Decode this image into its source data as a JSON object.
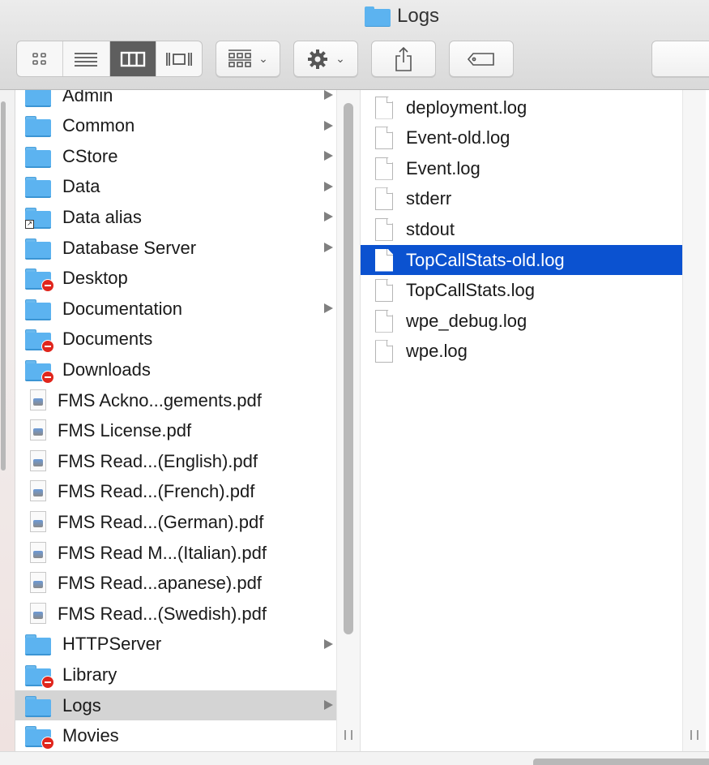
{
  "window": {
    "title": "Logs",
    "title_icon": "folder-icon"
  },
  "toolbar": {
    "view_modes": [
      {
        "name": "icon-view",
        "icon": "grid-icon",
        "active": false
      },
      {
        "name": "list-view",
        "icon": "list-icon",
        "active": false
      },
      {
        "name": "column-view",
        "icon": "columns-icon",
        "active": true
      },
      {
        "name": "cover-flow-view",
        "icon": "coverflow-icon",
        "active": false
      }
    ],
    "arrange_button": {
      "icon": "arrange-icon",
      "dropdown": true
    },
    "action_button": {
      "icon": "gear-icon",
      "dropdown": true
    },
    "share_button": {
      "icon": "share-icon"
    },
    "tags_button": {
      "icon": "tag-icon"
    },
    "search_placeholder": ""
  },
  "colors": {
    "selection": "#0b52d0",
    "inactive_highlight": "#d4d4d4",
    "folder": "#5cb3f0",
    "no_access_badge": "#e0261d"
  },
  "column1": {
    "items": [
      {
        "label": "Admin",
        "type": "folder",
        "has_children": true
      },
      {
        "label": "Common",
        "type": "folder",
        "has_children": true
      },
      {
        "label": "CStore",
        "type": "folder",
        "has_children": true
      },
      {
        "label": "Data",
        "type": "folder",
        "has_children": true
      },
      {
        "label": "Data alias",
        "type": "alias",
        "has_children": true
      },
      {
        "label": "Database Server",
        "type": "folder",
        "has_children": true
      },
      {
        "label": "Desktop",
        "type": "folder-restricted",
        "has_children": false
      },
      {
        "label": "Documentation",
        "type": "folder",
        "has_children": true
      },
      {
        "label": "Documents",
        "type": "folder-restricted",
        "has_children": false
      },
      {
        "label": "Downloads",
        "type": "folder-restricted",
        "has_children": false
      },
      {
        "label": "FMS Ackno...gements.pdf",
        "type": "pdf",
        "has_children": false
      },
      {
        "label": "FMS License.pdf",
        "type": "pdf",
        "has_children": false
      },
      {
        "label": "FMS Read...(English).pdf",
        "type": "pdf",
        "has_children": false
      },
      {
        "label": "FMS Read...(French).pdf",
        "type": "pdf",
        "has_children": false
      },
      {
        "label": "FMS Read...(German).pdf",
        "type": "pdf",
        "has_children": false
      },
      {
        "label": "FMS Read M...(Italian).pdf",
        "type": "pdf",
        "has_children": false
      },
      {
        "label": "FMS Read...apanese).pdf",
        "type": "pdf",
        "has_children": false
      },
      {
        "label": "FMS Read...(Swedish).pdf",
        "type": "pdf",
        "has_children": false
      },
      {
        "label": "HTTPServer",
        "type": "folder",
        "has_children": true
      },
      {
        "label": "Library",
        "type": "folder-restricted",
        "has_children": false
      },
      {
        "label": "Logs",
        "type": "folder",
        "has_children": true,
        "highlighted": true
      },
      {
        "label": "Movies",
        "type": "folder-restricted",
        "has_children": false
      }
    ]
  },
  "column2": {
    "items": [
      {
        "label": "deployment.log",
        "type": "document"
      },
      {
        "label": "Event-old.log",
        "type": "document"
      },
      {
        "label": "Event.log",
        "type": "document"
      },
      {
        "label": "stderr",
        "type": "document"
      },
      {
        "label": "stdout",
        "type": "document"
      },
      {
        "label": "TopCallStats-old.log",
        "type": "document",
        "selected": true
      },
      {
        "label": "TopCallStats.log",
        "type": "document"
      },
      {
        "label": "wpe_debug.log",
        "type": "document"
      },
      {
        "label": "wpe.log",
        "type": "document"
      }
    ]
  }
}
